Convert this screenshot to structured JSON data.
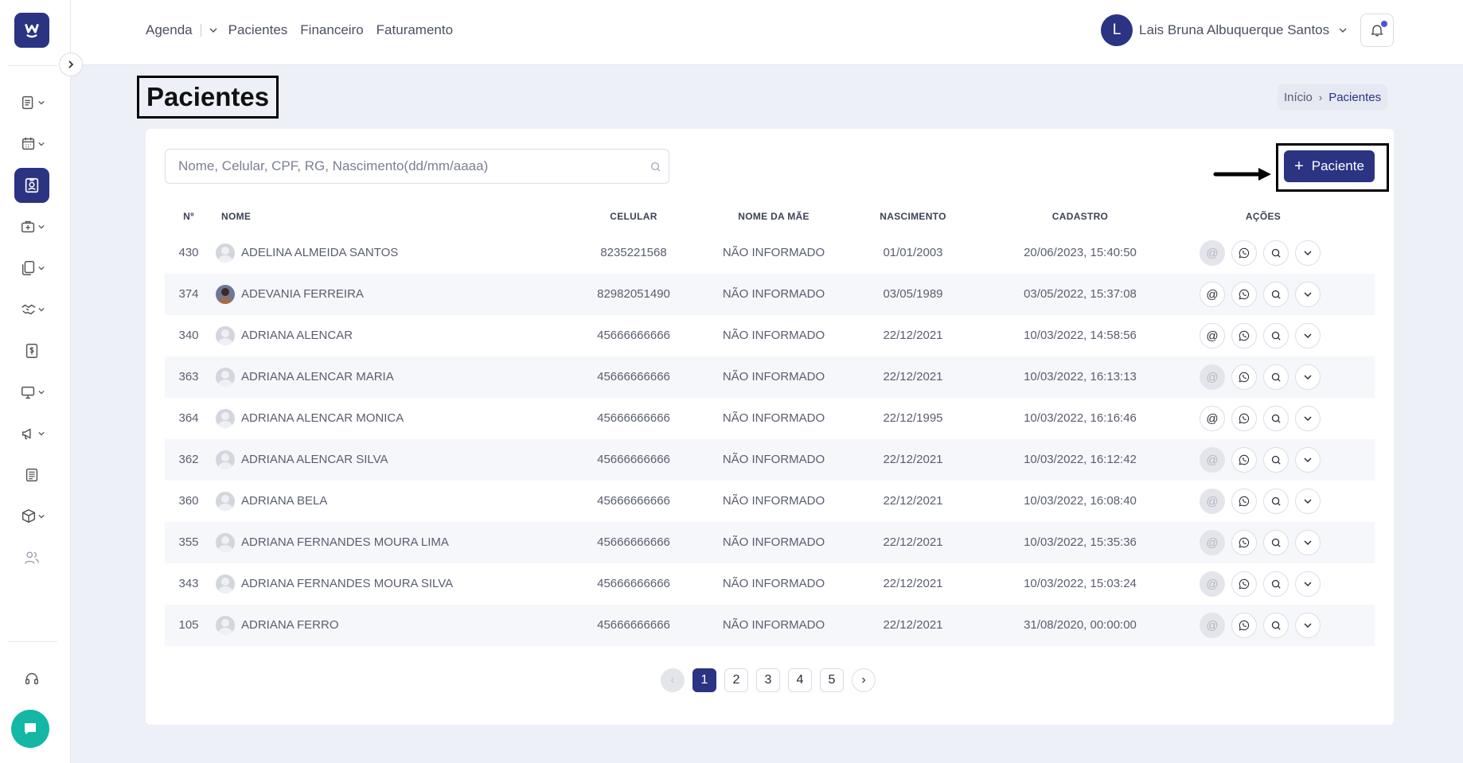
{
  "topnav": {
    "items": [
      "Agenda",
      "Pacientes",
      "Financeiro",
      "Faturamento"
    ]
  },
  "user": {
    "initial": "L",
    "name": "Lais Bruna Albuquerque Santos"
  },
  "page": {
    "title": "Pacientes"
  },
  "breadcrumb": {
    "home": "Início",
    "current": "Pacientes"
  },
  "search": {
    "placeholder": "Nome, Celular, CPF, RG, Nascimento(dd/mm/aaaa)"
  },
  "add_button": {
    "label": "Paciente"
  },
  "table": {
    "headers": [
      "Nº",
      "NOME",
      "CELULAR",
      "NOME DA MÃE",
      "NASCIMENTO",
      "CADASTRO",
      "AÇÕES"
    ],
    "rows": [
      {
        "num": "430",
        "name": "ADELINA ALMEIDA SANTOS",
        "cel": "8235221568",
        "mae": "NÃO INFORMADO",
        "nasc": "01/01/2003",
        "cad": "20/06/2023, 15:40:50",
        "email": false,
        "photo": false
      },
      {
        "num": "374",
        "name": "ADEVANIA FERREIRA",
        "cel": "82982051490",
        "mae": "NÃO INFORMADO",
        "nasc": "03/05/1989",
        "cad": "03/05/2022, 15:37:08",
        "email": true,
        "photo": true
      },
      {
        "num": "340",
        "name": "ADRIANA ALENCAR",
        "cel": "45666666666",
        "mae": "NÃO INFORMADO",
        "nasc": "22/12/2021",
        "cad": "10/03/2022, 14:58:56",
        "email": true,
        "photo": false
      },
      {
        "num": "363",
        "name": "ADRIANA ALENCAR MARIA",
        "cel": "45666666666",
        "mae": "NÃO INFORMADO",
        "nasc": "22/12/2021",
        "cad": "10/03/2022, 16:13:13",
        "email": false,
        "photo": false
      },
      {
        "num": "364",
        "name": "ADRIANA ALENCAR MONICA",
        "cel": "45666666666",
        "mae": "NÃO INFORMADO",
        "nasc": "22/12/1995",
        "cad": "10/03/2022, 16:16:46",
        "email": true,
        "photo": false
      },
      {
        "num": "362",
        "name": "ADRIANA ALENCAR SILVA",
        "cel": "45666666666",
        "mae": "NÃO INFORMADO",
        "nasc": "22/12/2021",
        "cad": "10/03/2022, 16:12:42",
        "email": false,
        "photo": false
      },
      {
        "num": "360",
        "name": "ADRIANA BELA",
        "cel": "45666666666",
        "mae": "NÃO INFORMADO",
        "nasc": "22/12/2021",
        "cad": "10/03/2022, 16:08:40",
        "email": false,
        "photo": false
      },
      {
        "num": "355",
        "name": "ADRIANA FERNANDES MOURA LIMA",
        "cel": "45666666666",
        "mae": "NÃO INFORMADO",
        "nasc": "22/12/2021",
        "cad": "10/03/2022, 15:35:36",
        "email": false,
        "photo": false
      },
      {
        "num": "343",
        "name": "ADRIANA FERNANDES MOURA SILVA",
        "cel": "45666666666",
        "mae": "NÃO INFORMADO",
        "nasc": "22/12/2021",
        "cad": "10/03/2022, 15:03:24",
        "email": false,
        "photo": false
      },
      {
        "num": "105",
        "name": "ADRIANA FERRO",
        "cel": "45666666666",
        "mae": "NÃO INFORMADO",
        "nasc": "22/12/2021",
        "cad": "31/08/2020, 00:00:00",
        "email": false,
        "photo": false
      }
    ]
  },
  "pagination": {
    "pages": [
      "1",
      "2",
      "3",
      "4",
      "5"
    ],
    "current": "1"
  },
  "colors": {
    "primary": "#2b3383",
    "chat": "#13b7a3",
    "background": "#eef0f8"
  },
  "icons": [
    "menu-list-icon",
    "calendar-icon",
    "patient-card-icon",
    "briefcase-icon",
    "documents-icon",
    "handshake-icon",
    "dollar-icon",
    "monitor-icon",
    "megaphone-icon",
    "news-icon",
    "box-icon",
    "users-icon",
    "headset-icon",
    "chat-icon"
  ]
}
